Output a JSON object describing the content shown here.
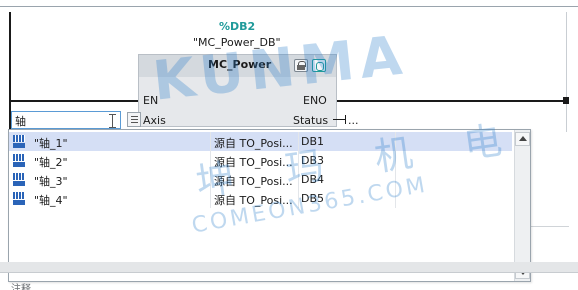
{
  "instance": {
    "operand": "%DB2",
    "name": "\"MC_Power_DB\""
  },
  "block": {
    "title": "MC_Power",
    "icons": [
      "lock-icon",
      "diagnostics-icon"
    ],
    "pins": {
      "en": "EN",
      "eno": "ENO",
      "axis": "Axis",
      "status": "Status",
      "status_value": "..."
    }
  },
  "input": {
    "value": "轴"
  },
  "dropdown": {
    "rows": [
      {
        "name": "\"轴_1\"",
        "source": "源自 TO_Posi...",
        "db": "DB1",
        "selected": true
      },
      {
        "name": "\"轴_2\"",
        "source": "源自 TO_Posi...",
        "db": "DB3",
        "selected": false
      },
      {
        "name": "\"轴_3\"",
        "source": "源自 TO_Posi...",
        "db": "DB4",
        "selected": false
      },
      {
        "name": "\"轴_4\"",
        "source": "源自 TO_Posi...",
        "db": "DB5",
        "selected": false
      }
    ]
  },
  "footer": {
    "comment_label": "注释"
  },
  "watermark": {
    "brand": "KUNMA",
    "chinese": "坤 玛 机 电",
    "site": "COMEON365.COM"
  },
  "colors": {
    "operand": "#1f9a9a",
    "selection": "#d5dff5",
    "axis_icon": "#2a64b8",
    "block_fill": "#e6e8eb",
    "watermark": "#2c7ec9"
  }
}
